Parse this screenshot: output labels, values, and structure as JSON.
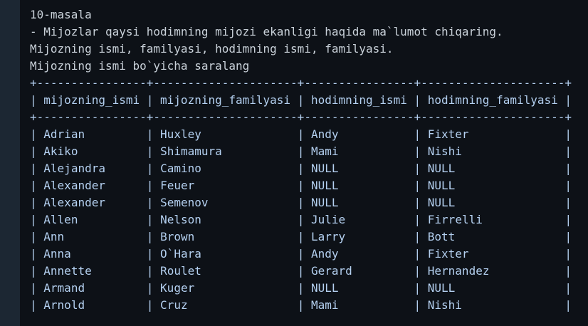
{
  "header_lines": [
    "10-masala",
    "- Mijozlar qaysi hodimning mijozi ekanligi haqida ma`lumot chiqaring.",
    "Mijozning ismi, familyasi, hodimning ismi, familyasi.",
    "Mijozning ismi bo`yicha saralang"
  ],
  "table": {
    "border": "+----------------+---------------------+----------------+---------------------+",
    "columns": [
      "mijozning_ismi",
      "mijozning_familyasi",
      "hodimning_ismi",
      "hodimning_familyasi"
    ],
    "rows": [
      [
        "Adrian",
        "Huxley",
        "Andy",
        "Fixter"
      ],
      [
        "Akiko",
        "Shimamura",
        "Mami",
        "Nishi"
      ],
      [
        "Alejandra",
        "Camino",
        "NULL",
        "NULL"
      ],
      [
        "Alexander",
        "Feuer",
        "NULL",
        "NULL"
      ],
      [
        "Alexander",
        "Semenov",
        "NULL",
        "NULL"
      ],
      [
        "Allen",
        "Nelson",
        "Julie",
        "Firrelli"
      ],
      [
        "Ann",
        "Brown",
        "Larry",
        "Bott"
      ],
      [
        "Anna",
        "O`Hara",
        "Andy",
        "Fixter"
      ],
      [
        "Annette",
        "Roulet",
        "Gerard",
        "Hernandez"
      ],
      [
        "Armand",
        "Kuger",
        "NULL",
        "NULL"
      ],
      [
        "Arnold",
        "Cruz",
        "Mami",
        "Nishi"
      ]
    ]
  },
  "colors": {
    "background": "#0d1117",
    "gutter": "#1c2733",
    "text": "#c9d1d9",
    "table_text": "#b4d0f0"
  }
}
